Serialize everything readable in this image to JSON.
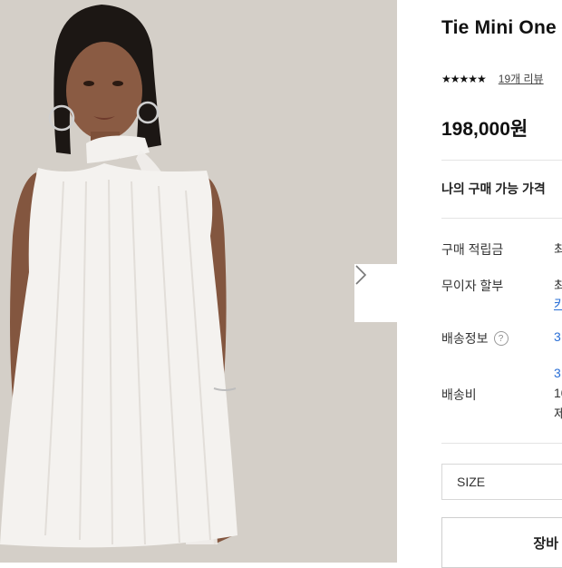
{
  "product": {
    "title": "Tie Mini One",
    "stars": "★★★★★",
    "review_link": "19개 리뷰",
    "price": "198,000원",
    "available_price_label": "나의 구매 가능 가격"
  },
  "details": {
    "reward_label": "구매 적립금",
    "reward_value": "최",
    "installment_label": "무이자 할부",
    "installment_value_1": "최",
    "installment_value_2": "카",
    "shipping_info_label": "배송정보",
    "shipping_info_value": "3",
    "shipping_fee_label": "배송비",
    "shipping_fee_value_1": "3,",
    "shipping_fee_value_2": "10",
    "shipping_fee_value_3": "제"
  },
  "options": {
    "size_label": "SIZE"
  },
  "actions": {
    "cart_label": "장바"
  },
  "icons": {
    "next": "chevron-right-icon",
    "help": "question-circle-icon",
    "star": "star-icon"
  },
  "colors": {
    "link_blue": "#2a6fd6",
    "background": "#ffffff",
    "photo_backdrop": "#d3cec7"
  }
}
